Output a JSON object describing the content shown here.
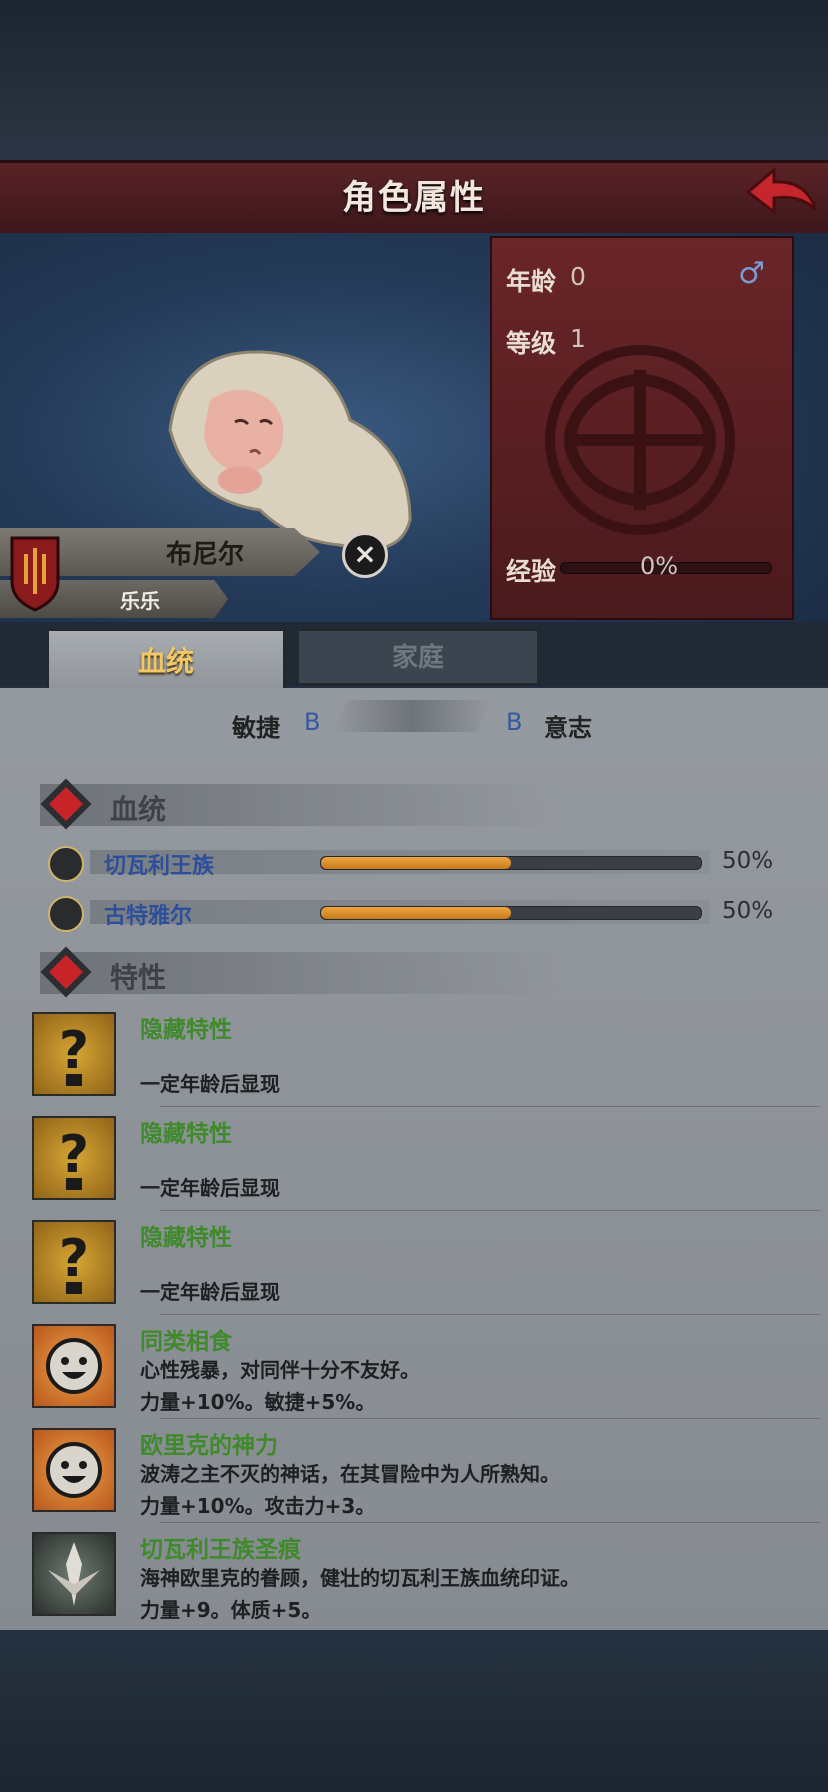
{
  "header": {
    "title": "角色属性"
  },
  "character": {
    "age_label": "年龄",
    "age": "0",
    "gender_symbol": "♂",
    "level_label": "等级",
    "level": "1",
    "exp_label": "经验",
    "exp_percent": "0%",
    "exp_fraction": 0,
    "name": "布尼尔",
    "nickname": "乐乐"
  },
  "tabs": [
    {
      "label": "血统",
      "active": true
    },
    {
      "label": "家庭",
      "active": false
    }
  ],
  "balance": {
    "left_label": "敏捷",
    "left_grade": "B",
    "right_grade": "B",
    "right_label": "意志"
  },
  "bloodline_section": {
    "title": "血统",
    "items": [
      {
        "name": "切瓦利王族",
        "percent": "50%",
        "fraction": 0.5,
        "icon": "scales-icon"
      },
      {
        "name": "古特雅尔",
        "percent": "50%",
        "fraction": 0.5,
        "icon": "tree-icon"
      }
    ]
  },
  "traits_section": {
    "title": "特性",
    "items": [
      {
        "name": "隐藏特性",
        "desc1": "",
        "desc2": "一定年龄后显现",
        "icon": "question-icon"
      },
      {
        "name": "隐藏特性",
        "desc1": "",
        "desc2": "一定年龄后显现",
        "icon": "question-icon"
      },
      {
        "name": "隐藏特性",
        "desc1": "",
        "desc2": "一定年龄后显现",
        "icon": "question-icon"
      },
      {
        "name": "同类相食",
        "desc1": "心性残暴，对同伴十分不友好。",
        "desc2": "力量+10%。敏捷+5%。",
        "icon": "smiley-icon"
      },
      {
        "name": "欧里克的神力",
        "desc1": "波涛之主不灭的神话，在其冒险中为人所熟知。",
        "desc2": "力量+10%。攻击力+3。",
        "icon": "smiley-icon"
      },
      {
        "name": "切瓦利王族圣痕",
        "desc1": "海神欧里克的眷顾，健壮的切瓦利王族血统印证。",
        "desc2": "力量+9。体质+5。",
        "icon": "crest-icon"
      }
    ]
  },
  "colors": {
    "header_red": "#5a2327",
    "trait_green": "#3f8a2a",
    "lineage_blue": "#2d4f9a",
    "bar_orange": "#e59a35"
  }
}
